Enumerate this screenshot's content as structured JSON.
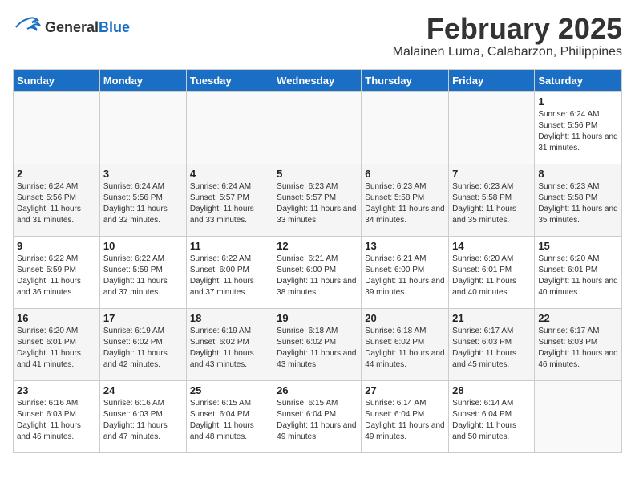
{
  "header": {
    "logo_line1": "General",
    "logo_line2": "Blue",
    "title": "February 2025",
    "subtitle": "Malainen Luma, Calabarzon, Philippines"
  },
  "calendar": {
    "days_of_week": [
      "Sunday",
      "Monday",
      "Tuesday",
      "Wednesday",
      "Thursday",
      "Friday",
      "Saturday"
    ],
    "weeks": [
      [
        {
          "day": "",
          "info": ""
        },
        {
          "day": "",
          "info": ""
        },
        {
          "day": "",
          "info": ""
        },
        {
          "day": "",
          "info": ""
        },
        {
          "day": "",
          "info": ""
        },
        {
          "day": "",
          "info": ""
        },
        {
          "day": "1",
          "info": "Sunrise: 6:24 AM\nSunset: 5:56 PM\nDaylight: 11 hours and 31 minutes."
        }
      ],
      [
        {
          "day": "2",
          "info": "Sunrise: 6:24 AM\nSunset: 5:56 PM\nDaylight: 11 hours and 31 minutes."
        },
        {
          "day": "3",
          "info": "Sunrise: 6:24 AM\nSunset: 5:56 PM\nDaylight: 11 hours and 32 minutes."
        },
        {
          "day": "4",
          "info": "Sunrise: 6:24 AM\nSunset: 5:57 PM\nDaylight: 11 hours and 33 minutes."
        },
        {
          "day": "5",
          "info": "Sunrise: 6:23 AM\nSunset: 5:57 PM\nDaylight: 11 hours and 33 minutes."
        },
        {
          "day": "6",
          "info": "Sunrise: 6:23 AM\nSunset: 5:58 PM\nDaylight: 11 hours and 34 minutes."
        },
        {
          "day": "7",
          "info": "Sunrise: 6:23 AM\nSunset: 5:58 PM\nDaylight: 11 hours and 35 minutes."
        },
        {
          "day": "8",
          "info": "Sunrise: 6:23 AM\nSunset: 5:58 PM\nDaylight: 11 hours and 35 minutes."
        }
      ],
      [
        {
          "day": "9",
          "info": "Sunrise: 6:22 AM\nSunset: 5:59 PM\nDaylight: 11 hours and 36 minutes."
        },
        {
          "day": "10",
          "info": "Sunrise: 6:22 AM\nSunset: 5:59 PM\nDaylight: 11 hours and 37 minutes."
        },
        {
          "day": "11",
          "info": "Sunrise: 6:22 AM\nSunset: 6:00 PM\nDaylight: 11 hours and 37 minutes."
        },
        {
          "day": "12",
          "info": "Sunrise: 6:21 AM\nSunset: 6:00 PM\nDaylight: 11 hours and 38 minutes."
        },
        {
          "day": "13",
          "info": "Sunrise: 6:21 AM\nSunset: 6:00 PM\nDaylight: 11 hours and 39 minutes."
        },
        {
          "day": "14",
          "info": "Sunrise: 6:20 AM\nSunset: 6:01 PM\nDaylight: 11 hours and 40 minutes."
        },
        {
          "day": "15",
          "info": "Sunrise: 6:20 AM\nSunset: 6:01 PM\nDaylight: 11 hours and 40 minutes."
        }
      ],
      [
        {
          "day": "16",
          "info": "Sunrise: 6:20 AM\nSunset: 6:01 PM\nDaylight: 11 hours and 41 minutes."
        },
        {
          "day": "17",
          "info": "Sunrise: 6:19 AM\nSunset: 6:02 PM\nDaylight: 11 hours and 42 minutes."
        },
        {
          "day": "18",
          "info": "Sunrise: 6:19 AM\nSunset: 6:02 PM\nDaylight: 11 hours and 43 minutes."
        },
        {
          "day": "19",
          "info": "Sunrise: 6:18 AM\nSunset: 6:02 PM\nDaylight: 11 hours and 43 minutes."
        },
        {
          "day": "20",
          "info": "Sunrise: 6:18 AM\nSunset: 6:02 PM\nDaylight: 11 hours and 44 minutes."
        },
        {
          "day": "21",
          "info": "Sunrise: 6:17 AM\nSunset: 6:03 PM\nDaylight: 11 hours and 45 minutes."
        },
        {
          "day": "22",
          "info": "Sunrise: 6:17 AM\nSunset: 6:03 PM\nDaylight: 11 hours and 46 minutes."
        }
      ],
      [
        {
          "day": "23",
          "info": "Sunrise: 6:16 AM\nSunset: 6:03 PM\nDaylight: 11 hours and 46 minutes."
        },
        {
          "day": "24",
          "info": "Sunrise: 6:16 AM\nSunset: 6:03 PM\nDaylight: 11 hours and 47 minutes."
        },
        {
          "day": "25",
          "info": "Sunrise: 6:15 AM\nSunset: 6:04 PM\nDaylight: 11 hours and 48 minutes."
        },
        {
          "day": "26",
          "info": "Sunrise: 6:15 AM\nSunset: 6:04 PM\nDaylight: 11 hours and 49 minutes."
        },
        {
          "day": "27",
          "info": "Sunrise: 6:14 AM\nSunset: 6:04 PM\nDaylight: 11 hours and 49 minutes."
        },
        {
          "day": "28",
          "info": "Sunrise: 6:14 AM\nSunset: 6:04 PM\nDaylight: 11 hours and 50 minutes."
        },
        {
          "day": "",
          "info": ""
        }
      ]
    ]
  }
}
